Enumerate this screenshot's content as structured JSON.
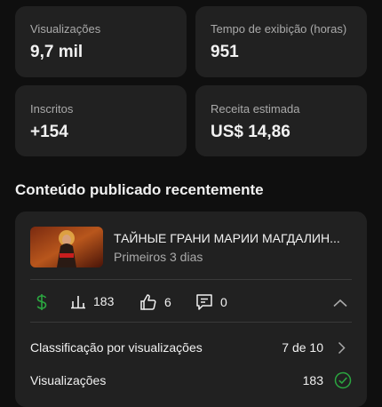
{
  "stats": [
    {
      "label": "Visualizações",
      "value": "9,7 mil"
    },
    {
      "label": "Tempo de exibição (horas)",
      "value": "951"
    },
    {
      "label": "Inscritos",
      "value": "+154"
    },
    {
      "label": "Receita estimada",
      "value": "US$ 14,86"
    }
  ],
  "recent": {
    "title": "Conteúdo publicado recentemente",
    "video": {
      "title": "ТАЙНЫЕ ГРАНИ МАРИИ МАГДАЛИН...",
      "subtitle": "Primeiros 3 dias"
    },
    "metrics": {
      "views": "183",
      "likes": "6",
      "comments": "0"
    },
    "rows": [
      {
        "label": "Classificação por visualizações",
        "value": "7 de 10"
      },
      {
        "label": "Visualizações",
        "value": "183"
      }
    ]
  },
  "colors": {
    "revenue_icon": "#2ba640",
    "check_icon": "#2ba640"
  }
}
